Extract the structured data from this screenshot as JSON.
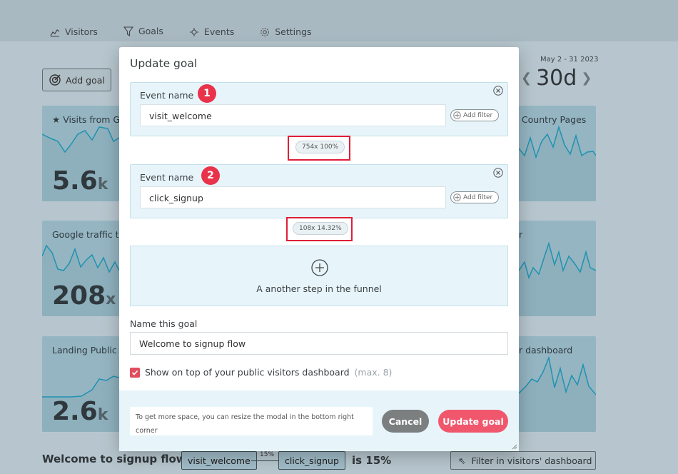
{
  "nav": {
    "tabs": [
      {
        "label": "Visitors",
        "icon": "chart-icon"
      },
      {
        "label": "Goals",
        "icon": "filter-icon"
      },
      {
        "label": "Events",
        "icon": "events-icon"
      },
      {
        "label": "Settings",
        "icon": "gear-icon"
      }
    ],
    "active_tab": "Goals"
  },
  "dashboard": {
    "add_goal_label": "Add goal",
    "date_range": "May 2 - 31 2023",
    "period": "30d",
    "cards": [
      {
        "label": "Visits from G",
        "value": "5.6",
        "suffix": "k",
        "starred": true
      },
      {
        "label": "Google traffic t",
        "value": "208",
        "suffix": "x"
      },
      {
        "label": "Landing Public",
        "value": "2.6",
        "suffix": "k"
      },
      {
        "label": "p Country Pages"
      },
      {
        "label": "r"
      },
      {
        "label": "r dashboard"
      }
    ],
    "bottom": {
      "title": "Welcome to signup flow",
      "step1": "visit_welcome",
      "step_pct": "15%",
      "step2": "click_signup",
      "result": "is 15%",
      "filter_btn": "Filter in visitors' dashboard"
    }
  },
  "modal": {
    "title": "Update goal",
    "steps": [
      {
        "number": "1",
        "label": "Event name",
        "value": "visit_welcome",
        "add_filter": "Add filter",
        "stat": "754x 100%"
      },
      {
        "number": "2",
        "label": "Event name",
        "value": "click_signup",
        "add_filter": "Add filter",
        "stat": "108x 14.32%"
      }
    ],
    "add_step_text": "A another step in the funnel",
    "name_label": "Name this goal",
    "name_value": "Welcome to signup flow",
    "checkbox_label": "Show on top of your public visitors dashboard",
    "checkbox_note": "(max. 8)",
    "checkbox_checked": true,
    "hint": "To get more space, you can resize the modal in the bottom right corner",
    "cancel": "Cancel",
    "submit": "Update goal"
  },
  "colors": {
    "accent": "#f1576c",
    "annotation": "#e01e38",
    "step_bg": "#e7f5fb"
  }
}
